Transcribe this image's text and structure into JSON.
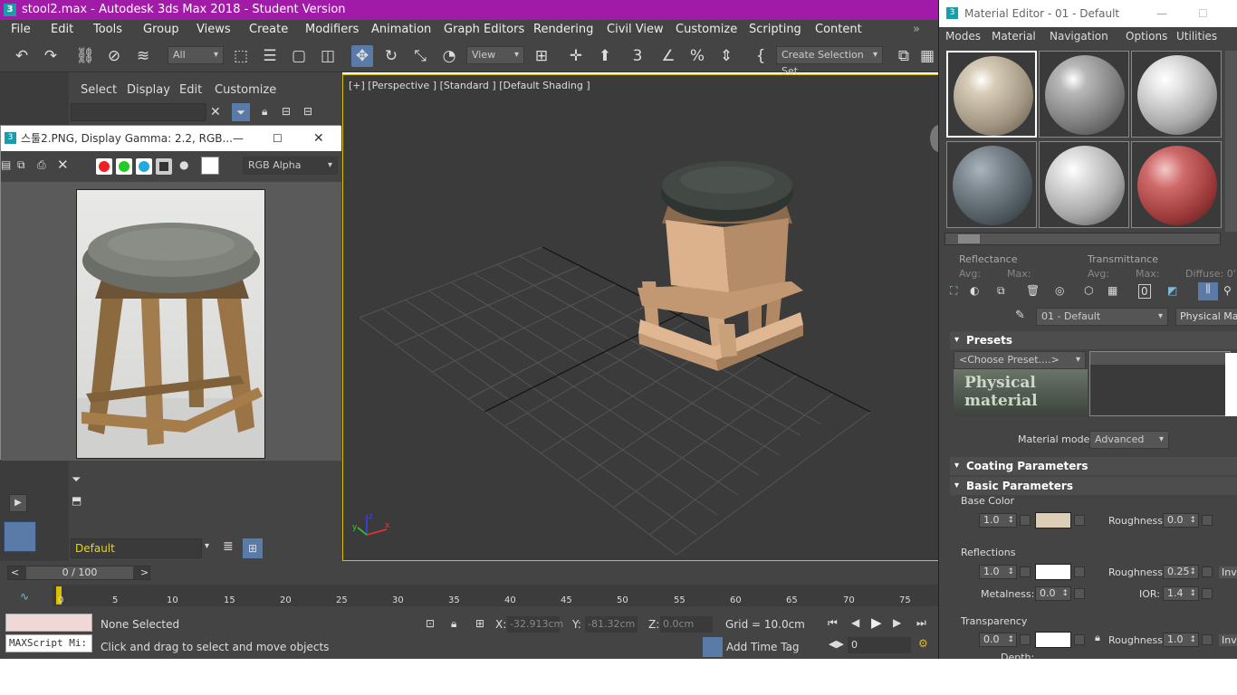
{
  "window": {
    "title": "stool2.max - Autodesk 3ds Max 2018 - Student Version",
    "icon": "3"
  },
  "menu": [
    "File",
    "Edit",
    "Tools",
    "Group",
    "Views",
    "Create",
    "Modifiers",
    "Animation",
    "Graph Editors",
    "Rendering",
    "Civil View",
    "Customize",
    "Scripting",
    "Content"
  ],
  "toolbar": {
    "filter_value": "All",
    "view_value": "View",
    "selection_set": "Create Selection Set"
  },
  "scene_explorer": {
    "tabs": [
      "Select",
      "Display",
      "Edit",
      "Customize"
    ],
    "layer_value": "Default"
  },
  "viewport": {
    "label": "[+] [Perspective ] [Standard ] [Default Shading ]"
  },
  "image_window": {
    "title": "스툴2.PNG, Display Gamma: 2.2, RGB...",
    "channel": "RGB Alpha"
  },
  "timeline": {
    "frame": "0 / 100",
    "ticks": [
      "0",
      "5",
      "10",
      "15",
      "20",
      "25",
      "30",
      "35",
      "40",
      "45",
      "50",
      "55",
      "60",
      "65",
      "70",
      "75"
    ]
  },
  "status": {
    "selection": "None Selected",
    "hint": "Click and drag to select and move objects",
    "maxscript": "MAXScript Mi:",
    "x_label": "X:",
    "x_value": "-32.913cm",
    "y_label": "Y:",
    "y_value": "-81.32cm",
    "z_label": "Z:",
    "z_value": "0.0cm",
    "grid": "Grid = 10.0cm",
    "add_time_tag": "Add Time Tag",
    "frame_value": "0"
  },
  "material_editor": {
    "title": "Material Editor - 01 - Default",
    "menu": [
      "Modes",
      "Material",
      "Navigation",
      "Options",
      "Utilities"
    ],
    "reflectance": "Reflectance",
    "transmittance": "Transmittance",
    "avg": "Avg:",
    "max": "Max:",
    "diffuse": "Diffuse: 0'",
    "material_name": "01 - Default",
    "material_type": "Physical Mate",
    "presets_label": "Presets",
    "choose_preset": "<Choose Preset....>",
    "logo_text": "Physical material",
    "material_mode_label": "Material mode:",
    "material_mode_value": "Advanced",
    "coating_label": "Coating Parameters",
    "basic_label": "Basic Parameters",
    "base_color_label": "Base Color",
    "base_weight": "1.0",
    "roughness_label": "Roughness:",
    "base_roughness": "0.0",
    "reflections_label": "Reflections",
    "refl_weight": "1.0",
    "refl_roughness": "0.25",
    "inv": "Inv",
    "metalness_label": "Metalness:",
    "metalness": "0.0",
    "ior_label": "IOR:",
    "ior": "1.4",
    "transparency_label": "Transparency",
    "trans_weight": "0.0",
    "trans_roughness": "1.0",
    "depth_label": "Depth:"
  }
}
